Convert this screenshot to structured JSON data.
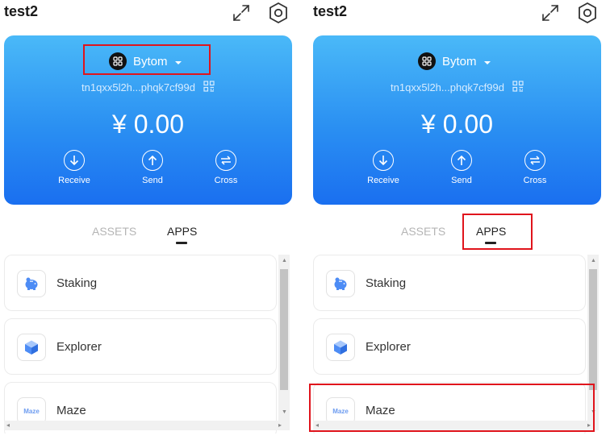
{
  "panels": [
    {
      "wallet_name": "test2",
      "chain": {
        "name": "Bytom",
        "icon": "bytom-logo-icon"
      },
      "address": "tn1qxx5l2h...phqk7cf99d",
      "balance": "¥ 0.00",
      "actions": [
        {
          "label": "Receive",
          "icon": "arrow-down-circle-icon"
        },
        {
          "label": "Send",
          "icon": "arrow-up-circle-icon"
        },
        {
          "label": "Cross",
          "icon": "transfer-circle-icon"
        }
      ],
      "tabs": [
        {
          "label": "ASSETS",
          "active": false
        },
        {
          "label": "APPS",
          "active": true
        }
      ],
      "apps": [
        {
          "label": "Staking",
          "icon": "piggy-bank-icon"
        },
        {
          "label": "Explorer",
          "icon": "cube-icon"
        },
        {
          "label": "Maze",
          "icon_text": "Maze"
        }
      ],
      "highlight": "chain-selector"
    },
    {
      "wallet_name": "test2",
      "chain": {
        "name": "Bytom",
        "icon": "bytom-logo-icon"
      },
      "address": "tn1qxx5l2h...phqk7cf99d",
      "balance": "¥ 0.00",
      "actions": [
        {
          "label": "Receive",
          "icon": "arrow-down-circle-icon"
        },
        {
          "label": "Send",
          "icon": "arrow-up-circle-icon"
        },
        {
          "label": "Cross",
          "icon": "transfer-circle-icon"
        }
      ],
      "tabs": [
        {
          "label": "ASSETS",
          "active": false
        },
        {
          "label": "APPS",
          "active": true
        }
      ],
      "apps": [
        {
          "label": "Staking",
          "icon": "piggy-bank-icon"
        },
        {
          "label": "Explorer",
          "icon": "cube-icon"
        },
        {
          "label": "Maze",
          "icon_text": "Maze"
        }
      ],
      "highlight": [
        "apps-tab",
        "maze-app"
      ]
    }
  ],
  "colors": {
    "card_gradient_top": "#4ab9f8",
    "card_gradient_bottom": "#1a6ff0",
    "highlight": "#e0141c",
    "tab_inactive": "#b5b5b5",
    "app_icon_blue": "#4d8cf5"
  }
}
